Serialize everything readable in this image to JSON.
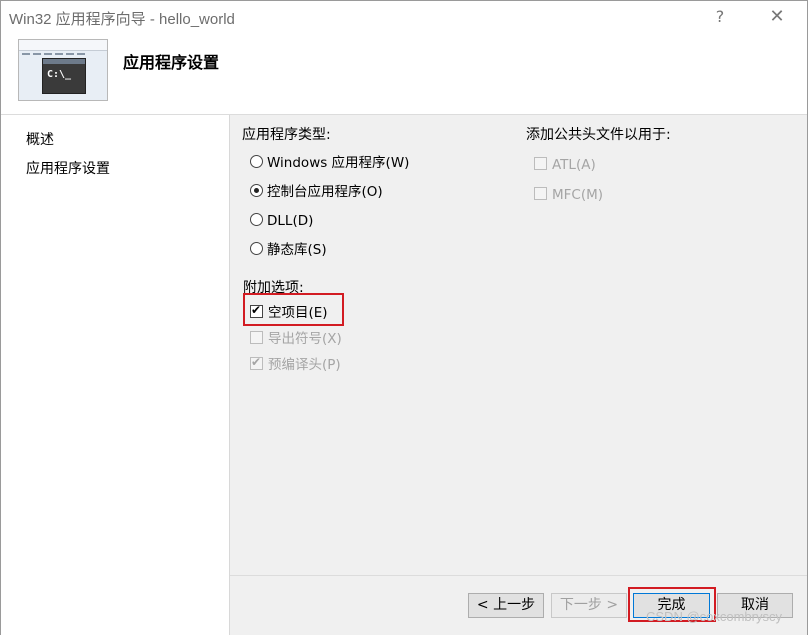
{
  "window": {
    "title": "Win32 应用程序向导 - hello_world",
    "help_label": "?",
    "close_label": "✕"
  },
  "header": {
    "title": "应用程序设置",
    "console_text": "C:\\_"
  },
  "sidebar": {
    "items": [
      {
        "label": "概述"
      },
      {
        "label": "应用程序设置"
      }
    ]
  },
  "app_type": {
    "label": "应用程序类型:",
    "options": [
      {
        "label": "Windows 应用程序(W)",
        "checked": false
      },
      {
        "label": "控制台应用程序(O)",
        "checked": true
      },
      {
        "label": "DLL(D)",
        "checked": false
      },
      {
        "label": "静态库(S)",
        "checked": false
      }
    ]
  },
  "headers": {
    "label": "添加公共头文件以用于:",
    "options": [
      {
        "label": "ATL(A)",
        "checked": false,
        "enabled": false
      },
      {
        "label": "MFC(M)",
        "checked": false,
        "enabled": false
      }
    ]
  },
  "additional": {
    "label": "附加选项:",
    "options": [
      {
        "label": "空项目(E)",
        "checked": true,
        "enabled": true
      },
      {
        "label": "导出符号(X)",
        "checked": false,
        "enabled": false
      },
      {
        "label": "预编译头(P)",
        "checked": true,
        "enabled": false
      }
    ]
  },
  "footer": {
    "prev_label": "< 上一步",
    "next_label": "下一步 >",
    "finish_label": "完成",
    "cancel_label": "取消"
  },
  "watermark": "CSDN @coxcombryscy",
  "colors": {
    "highlight": "#d21b22"
  }
}
